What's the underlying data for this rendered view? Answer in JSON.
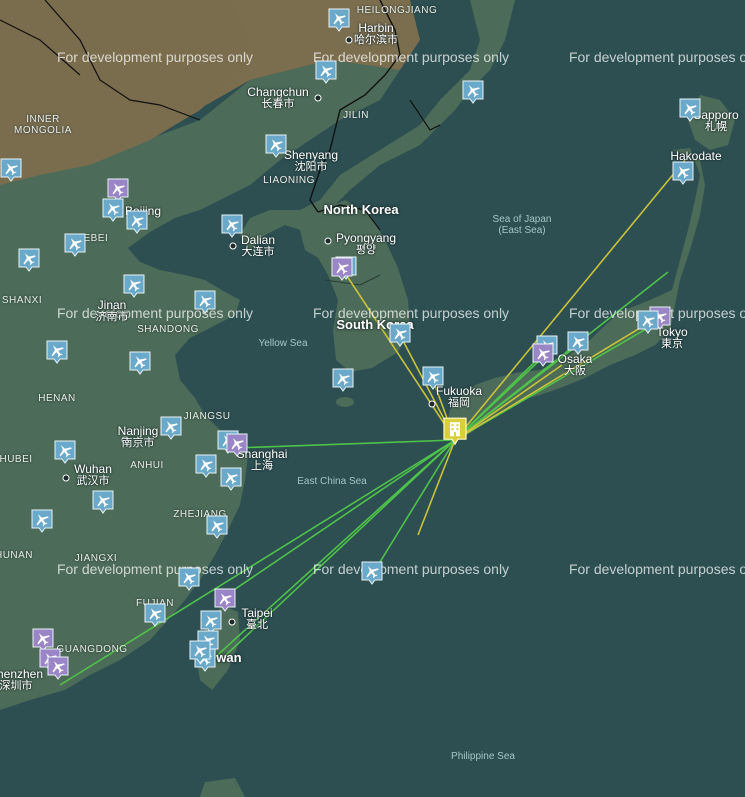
{
  "map": {
    "colors": {
      "sea": "#2d4f52",
      "land": "#4c6b58",
      "land_north": "#7e7152",
      "route_yellow": "#c9c23a",
      "route_green": "#4fc24a",
      "pin_blue": "#6aa9c9",
      "pin_purple": "#9a86c7",
      "hotel": "#d9cf3a"
    },
    "watermark": "For development purposes only",
    "cities": [
      {
        "name": "Harbin",
        "local": "哈尔滨市"
      },
      {
        "name": "Changchun",
        "local": "长春市"
      },
      {
        "name": "Shenyang",
        "local": "沈阳市"
      },
      {
        "name": "Dalian",
        "local": "大连市"
      },
      {
        "name": "Pyongyang",
        "local": "평양"
      },
      {
        "name": "Jinan",
        "local": "济南市"
      },
      {
        "name": "Nanjing",
        "local": "南京市"
      },
      {
        "name": "Shanghai",
        "local": "上海"
      },
      {
        "name": "Wuhan",
        "local": "武汉市"
      },
      {
        "name": "Taipei",
        "local": "臺北"
      },
      {
        "name": "Shenzhen",
        "local": "深圳市"
      },
      {
        "name": "Fukuoka",
        "local": "福岡"
      },
      {
        "name": "Osaka",
        "local": "大阪"
      },
      {
        "name": "Tokyo",
        "local": "東京"
      },
      {
        "name": "Sapporo",
        "local": "札幌"
      },
      {
        "name": "Hakodate",
        "local": ""
      },
      {
        "name": "Beijing",
        "local": ""
      }
    ],
    "countries": [
      "North Korea",
      "South Korea",
      "Taiwan"
    ],
    "regions": [
      "HEILONGJIANG",
      "JILIN",
      "LIAONING",
      "INNER MONGOLIA",
      "HEBEI",
      "SHANXI",
      "SHANDONG",
      "HENAN",
      "JIANGSU",
      "ANHUI",
      "HUBEI",
      "ZHEJIANG",
      "JIANGXI",
      "FUJIAN",
      "GUANGDONG",
      "HUNAN"
    ],
    "seas": [
      "Sea of Japan (East Sea)",
      "Yellow Sea",
      "East China Sea",
      "Philippine Sea"
    ],
    "hotel_icon": "hotel-building-icon",
    "pin_icon": "airplane-icon"
  }
}
